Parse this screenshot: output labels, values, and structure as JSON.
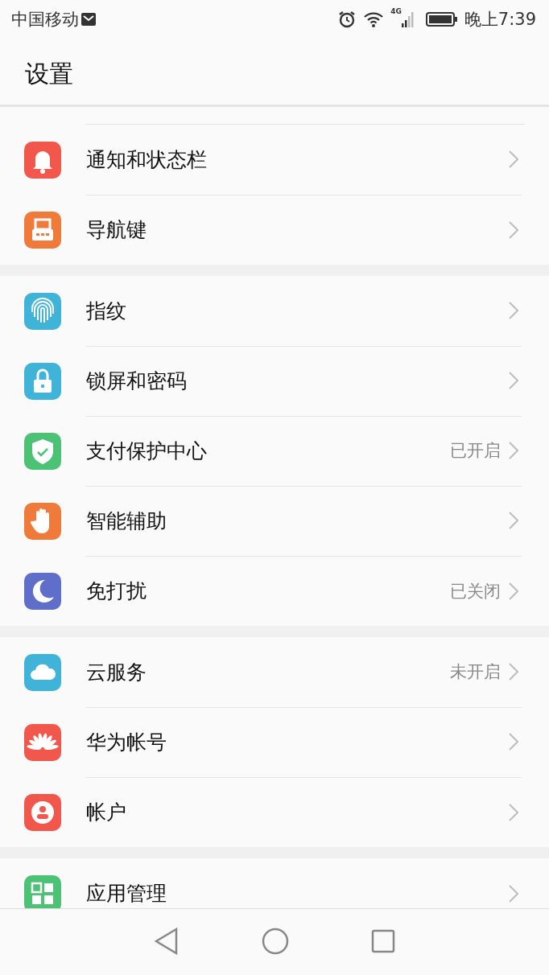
{
  "status_bar": {
    "carrier": "中国移动",
    "network": "4G",
    "time": "晚上7:39"
  },
  "header": {
    "title": "设置"
  },
  "groups": [
    {
      "items": [
        {
          "label": "通知和状态栏",
          "kind": "bell",
          "color": "#f2574c"
        },
        {
          "label": "导航键",
          "kind": "navkeys",
          "color": "#f07a3a"
        }
      ]
    },
    {
      "items": [
        {
          "label": "指纹",
          "kind": "fingerprint",
          "color": "#3fb4d8"
        },
        {
          "label": "锁屏和密码",
          "kind": "lock",
          "color": "#3fb4d8"
        },
        {
          "label": "支付保护中心",
          "value": "已开启",
          "kind": "shield",
          "color": "#4cc274"
        },
        {
          "label": "智能辅助",
          "kind": "hand",
          "color": "#f07a3a"
        },
        {
          "label": "免打扰",
          "value": "已关闭",
          "kind": "moon",
          "color": "#5f6fc9"
        }
      ]
    },
    {
      "items": [
        {
          "label": "云服务",
          "value": "未开启",
          "kind": "cloud",
          "color": "#3fb4d8"
        },
        {
          "label": "华为帐号",
          "kind": "petals",
          "color": "#f2574c"
        },
        {
          "label": "帐户",
          "kind": "person",
          "color": "#f2574c"
        }
      ]
    },
    {
      "items": [
        {
          "label": "应用管理",
          "kind": "grid",
          "color": "#4cc274"
        }
      ]
    }
  ]
}
